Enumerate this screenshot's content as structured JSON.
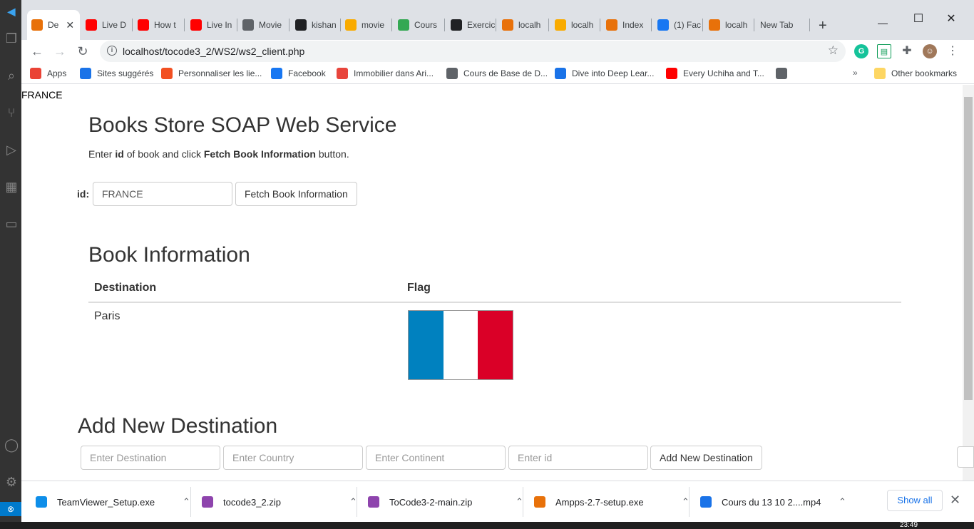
{
  "tabs": [
    {
      "label": "De",
      "color": "#e8710a"
    },
    {
      "label": "Live D",
      "color": "#ff0000"
    },
    {
      "label": "How t",
      "color": "#ff0000"
    },
    {
      "label": "Live In",
      "color": "#ff0000"
    },
    {
      "label": "Movie",
      "color": "#5f6368"
    },
    {
      "label": "kishan",
      "color": "#202124"
    },
    {
      "label": "movie",
      "color": "#f9ab00"
    },
    {
      "label": "Cours",
      "color": "#34a853"
    },
    {
      "label": "Exercic",
      "color": "#202124"
    },
    {
      "label": "localh",
      "color": "#e8710a"
    },
    {
      "label": "localh",
      "color": "#f9ab00"
    },
    {
      "label": "Index",
      "color": "#e8710a"
    },
    {
      "label": "(1) Fac",
      "color": "#1877f2"
    },
    {
      "label": "localh",
      "color": "#e8710a"
    },
    {
      "label": "New Tab",
      "color": ""
    }
  ],
  "toolbar": {
    "url": "localhost/tocode3_2/WS2/ws2_client.php"
  },
  "bookmarks": [
    {
      "label": "Apps",
      "color": "#ea4335"
    },
    {
      "label": "Sites suggérés",
      "color": "#1a73e8"
    },
    {
      "label": "Personnaliser les lie...",
      "color": "#f25022"
    },
    {
      "label": "Facebook",
      "color": "#1877f2"
    },
    {
      "label": "Immobilier dans Ari...",
      "color": "#e8453c"
    },
    {
      "label": "Cours de Base de D...",
      "color": "#5f6368"
    },
    {
      "label": "Dive into Deep Lear...",
      "color": "#1a73e8"
    },
    {
      "label": "Every Uchiha and T...",
      "color": "#ff0000"
    },
    {
      "label": "",
      "color": "#5f6368"
    }
  ],
  "bookmarks_other": "Other bookmarks",
  "page": {
    "echo_text": "FRANCE",
    "title": "Books Store SOAP Web Service",
    "instr_pre": "Enter ",
    "instr_id": "id",
    "instr_mid": " of book and click ",
    "instr_btn": "Fetch Book Information",
    "instr_post": " button.",
    "id_label": "id:",
    "id_value": "FRANCE",
    "fetch_button": "Fetch Book Information",
    "info_title": "Book Information",
    "table": {
      "headers": [
        "Destination",
        "Flag"
      ],
      "row": {
        "destination": "Paris",
        "flag": "France flag"
      }
    },
    "flag_colors": [
      "#0081bf",
      "#ffffff",
      "#da0027"
    ],
    "add_title": "Add New Destination",
    "add_form": {
      "destination_placeholder": "Enter Destination",
      "country_placeholder": "Enter Country",
      "continent_placeholder": "Enter Continent",
      "id_placeholder": "Enter id",
      "submit": "Add New Destination"
    }
  },
  "downloads": [
    {
      "name": "TeamViewer_Setup.exe",
      "color": "#0e8ee9"
    },
    {
      "name": "tocode3_2.zip",
      "color": "#8e44ad"
    },
    {
      "name": "ToCode3-2-main.zip",
      "color": "#8e44ad"
    },
    {
      "name": "Ampps-2.7-setup.exe",
      "color": "#e8710a"
    },
    {
      "name": "Cours du 13 10 2....mp4",
      "color": "#1a73e8"
    }
  ],
  "show_all": "Show all",
  "clock": "23:49"
}
